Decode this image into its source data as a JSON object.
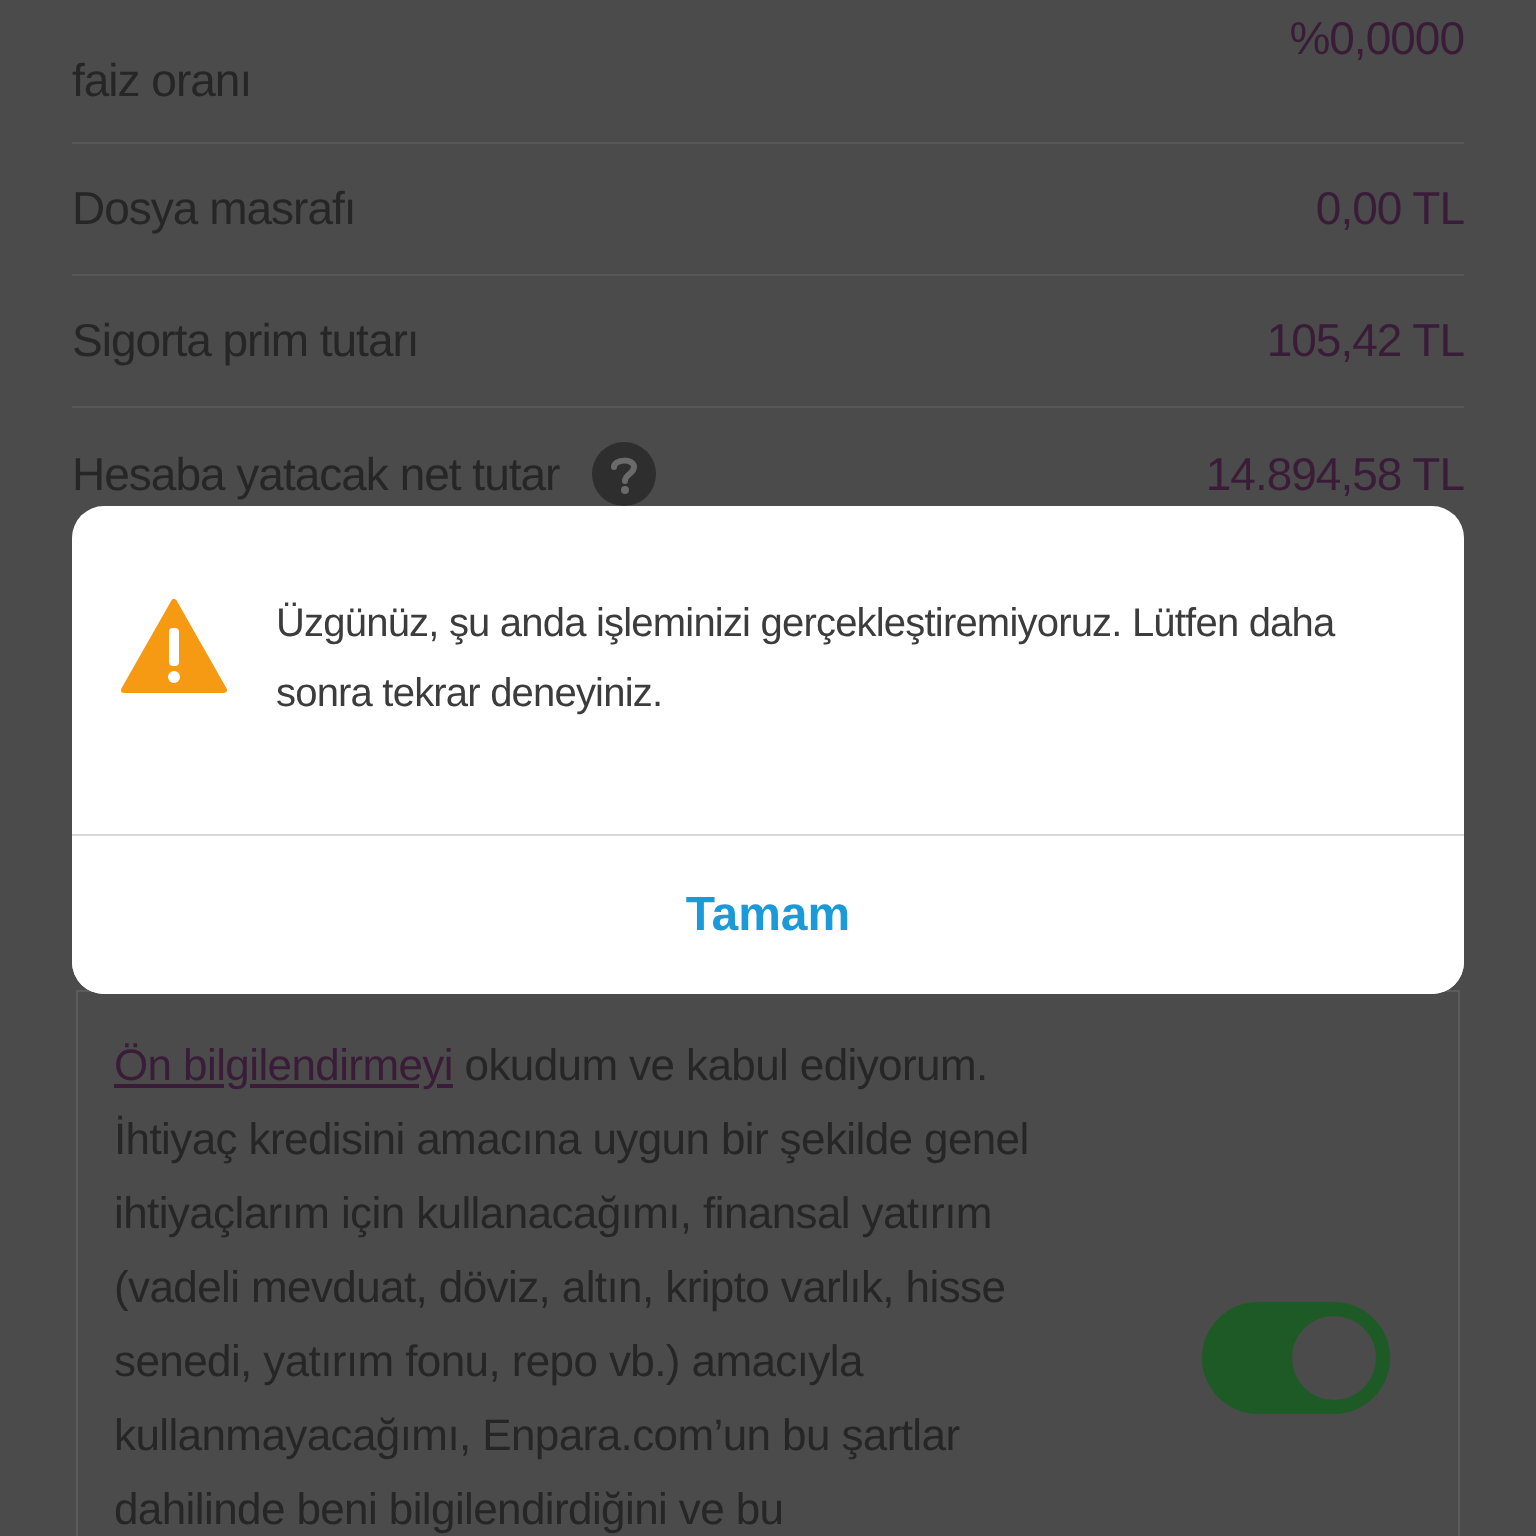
{
  "rows": [
    {
      "label": "faiz oranı",
      "value": "%0,0000",
      "help": false
    },
    {
      "label": "Dosya masrafı",
      "value": "0,00 TL",
      "help": false
    },
    {
      "label": "Sigorta prim tutarı",
      "value": "105,42 TL",
      "help": false
    },
    {
      "label": "Hesaba yatacak net tutar",
      "value": "14.894,58 TL",
      "help": true
    }
  ],
  "consent": {
    "link": "Ön bilgilendirmeyi",
    "text": " okudum ve kabul ediyorum. İhtiyaç kredisini amacına uygun bir şekilde genel ihtiyaçlarım için kullanacağımı, finansal yatırım (vadeli mevduat, döviz, altın, kripto varlık, hisse senedi, yatırım fonu, repo vb.) amacıyla kullanmayacağımı, Enpara.com’un bu şartlar dahilinde beni bilgilendirdiğini ve bu",
    "on": true
  },
  "dialog": {
    "message": "Üzgünüz, şu anda işleminizi gerçekleştiremiyoruz. Lütfen daha sonra tekrar deneyiniz.",
    "button": "Tamam"
  }
}
